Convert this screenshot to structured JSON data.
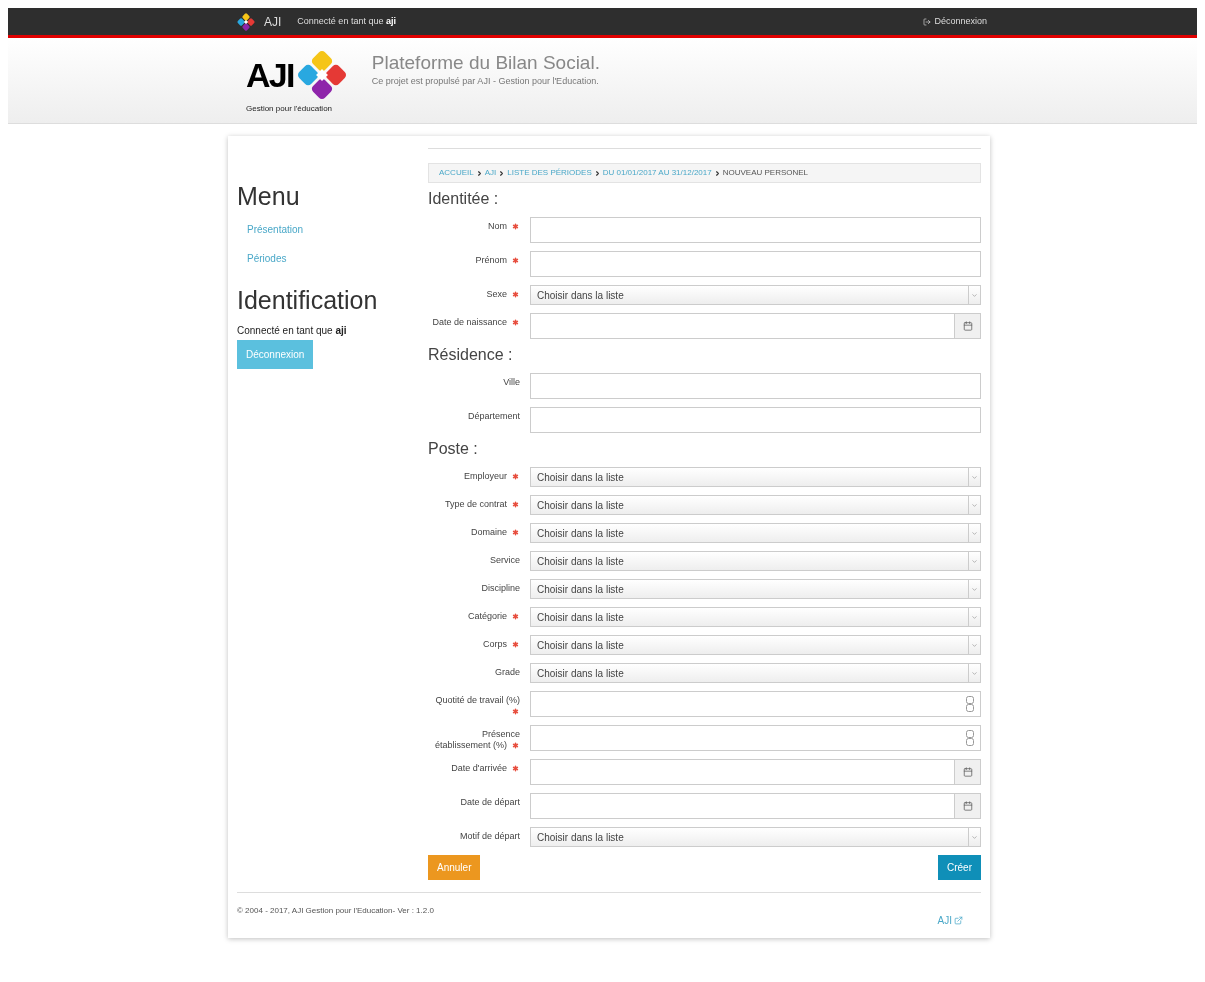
{
  "topbar": {
    "brand": "AJI",
    "user_prefix": "Connecté en tant que ",
    "user": "aji",
    "logout": "Déconnexion"
  },
  "header": {
    "logo_text": "AJI",
    "logo_tagline": "Gestion pour l'éducation",
    "title": "Plateforme du Bilan Social.",
    "subtitle": "Ce projet est propulsé par AJI - Gestion pour l'Education."
  },
  "sidebar": {
    "menu_title": "Menu",
    "items": [
      {
        "label": "Présentation"
      },
      {
        "label": "Périodes"
      }
    ],
    "ident_title": "Identification",
    "user_prefix": "Connecté en tant que ",
    "user": "aji",
    "logout": "Déconnexion"
  },
  "breadcrumb": [
    {
      "label": "ACCUEIL",
      "link": true
    },
    {
      "label": "AJI",
      "link": true
    },
    {
      "label": "LISTE DES PÉRIODES",
      "link": true
    },
    {
      "label": "DU 01/01/2017 AU 31/12/2017",
      "link": true
    },
    {
      "label": "NOUVEAU PERSONEL",
      "link": false
    }
  ],
  "sections": [
    {
      "title": "Identitée :",
      "fields": [
        {
          "label": "Nom",
          "required": true,
          "kind": "text"
        },
        {
          "label": "Prénom",
          "required": true,
          "kind": "text"
        },
        {
          "label": "Sexe",
          "required": true,
          "kind": "select",
          "value": "Choisir dans la liste"
        },
        {
          "label": "Date de naissance",
          "required": true,
          "kind": "date"
        }
      ]
    },
    {
      "title": "Résidence :",
      "fields": [
        {
          "label": "Ville",
          "required": false,
          "kind": "text"
        },
        {
          "label": "Département",
          "required": false,
          "kind": "text"
        }
      ]
    },
    {
      "title": "Poste :",
      "fields": [
        {
          "label": "Employeur",
          "required": true,
          "kind": "select",
          "value": "Choisir dans la liste"
        },
        {
          "label": "Type de contrat",
          "required": true,
          "kind": "select",
          "value": "Choisir dans la liste"
        },
        {
          "label": "Domaine",
          "required": true,
          "kind": "select",
          "value": "Choisir dans la liste"
        },
        {
          "label": "Service",
          "required": false,
          "kind": "select",
          "value": "Choisir dans la liste"
        },
        {
          "label": "Discipline",
          "required": false,
          "kind": "select",
          "value": "Choisir dans la liste"
        },
        {
          "label": "Catégorie",
          "required": true,
          "kind": "select",
          "value": "Choisir dans la liste"
        },
        {
          "label": "Corps",
          "required": true,
          "kind": "select",
          "value": "Choisir dans la liste"
        },
        {
          "label": "Grade",
          "required": false,
          "kind": "select",
          "value": "Choisir dans la liste"
        },
        {
          "label": "Quotité de travail (%)",
          "required": true,
          "kind": "number"
        },
        {
          "label": "Présence établissement (%)",
          "required": true,
          "kind": "number"
        },
        {
          "label": "Date d'arrivée",
          "required": true,
          "kind": "date"
        },
        {
          "label": "Date de départ",
          "required": false,
          "kind": "date"
        },
        {
          "label": "Motif de départ",
          "required": false,
          "kind": "select",
          "value": "Choisir dans la liste"
        }
      ]
    }
  ],
  "buttons": {
    "cancel": "Annuler",
    "create": "Créer"
  },
  "footer": {
    "copyright": "© 2004 - 2017, AJI Gestion pour l'Education- Ver : 1.2.0",
    "link": "AJI"
  }
}
